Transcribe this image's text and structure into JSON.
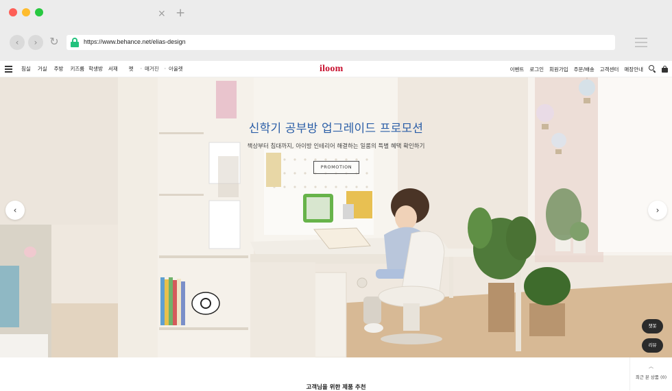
{
  "browser": {
    "url": "https://www.behance.net/elias-design",
    "tab_close": "×",
    "tab_new": "+",
    "back": "‹",
    "forward": "›",
    "reload": "↻"
  },
  "header": {
    "logo": "iloom",
    "gnb": [
      "침실",
      "거실",
      "주방",
      "키즈룸",
      "학생방",
      "서재",
      "펫"
    ],
    "sub_links": [
      "매거진",
      "아울렛"
    ],
    "util": [
      "이벤트",
      "로그인",
      "회원가입",
      "주문/배송",
      "고객센터",
      "매장안내"
    ]
  },
  "hero": {
    "title": "신학기 공부방 업그레이드 프로모션",
    "subtitle": "책상부터 침대까지, 아이방 인테리어 해결하는 일룸의 특별 혜택 확인하기",
    "button": "PROMOTION",
    "prev": "‹",
    "next": "›"
  },
  "floating": {
    "chat": "챗봇",
    "review": "리뷰"
  },
  "recent": {
    "arrow": "︿",
    "label": "최근 본 상품 (0)"
  },
  "section": {
    "title": "고객님을 위한 제품 추천"
  },
  "colors": {
    "brand": "#c8102e",
    "hero_title": "#2b5ea7",
    "secure": "#23c27d"
  }
}
